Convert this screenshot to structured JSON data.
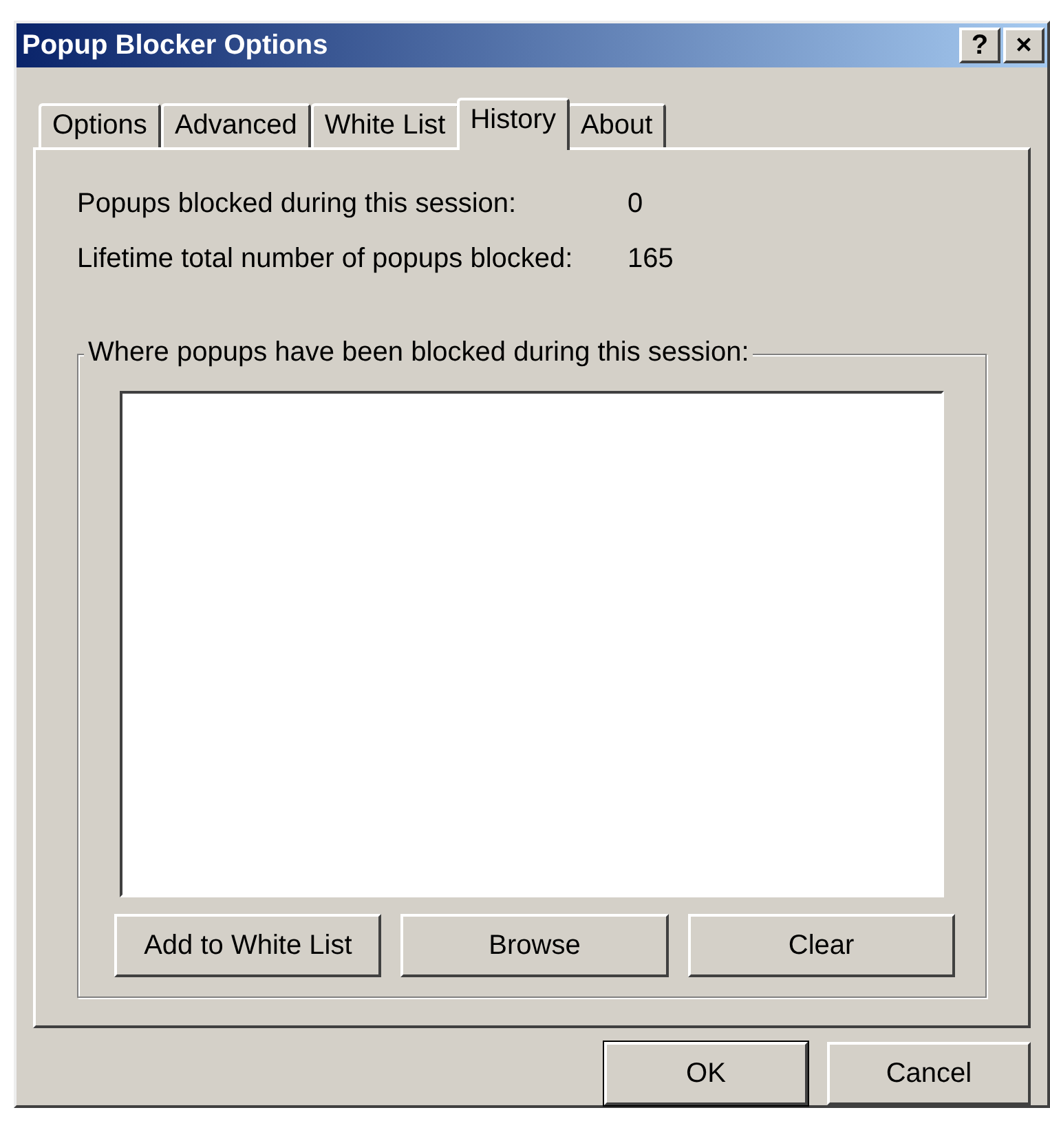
{
  "window": {
    "title": "Popup Blocker Options",
    "title_buttons": [
      "?",
      "×"
    ]
  },
  "tabs": [
    {
      "label": "Options",
      "selected": false
    },
    {
      "label": "Advanced",
      "selected": false
    },
    {
      "label": "White List",
      "selected": false
    },
    {
      "label": "History",
      "selected": true
    },
    {
      "label": "About",
      "selected": false
    }
  ],
  "stats": [
    {
      "label": "Popups blocked during this session:",
      "value": "0"
    },
    {
      "label": "Lifetime total number of popups blocked:",
      "value": "165"
    }
  ],
  "group": {
    "title": "Where popups have been blocked during this session:",
    "buttons": [
      "Add to White List",
      "Browse",
      "Clear"
    ]
  },
  "buttons": [
    {
      "label": "OK",
      "default": true
    },
    {
      "label": "Cancel",
      "default": false
    }
  ]
}
